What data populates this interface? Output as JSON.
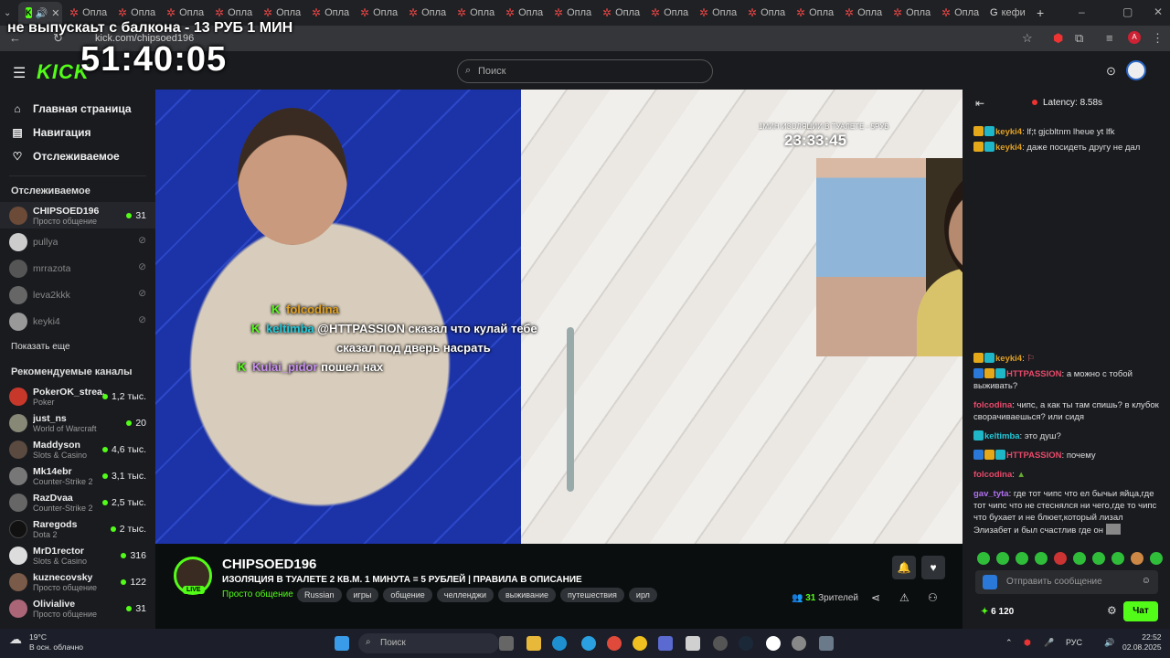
{
  "browser": {
    "tabs": {
      "first_active_label": "",
      "repeated_label": "Опла",
      "last_label": "кефи"
    },
    "url": "kick.com/chipsoed196"
  },
  "overlay": {
    "title": "не выпускаьт с балкона - 13 РУБ 1 МИН",
    "timer": "51:40:05"
  },
  "header": {
    "logo": "KICK",
    "search_placeholder": "Поиск"
  },
  "sidebar": {
    "nav": [
      {
        "label": "Главная страница",
        "icon": "home-icon"
      },
      {
        "label": "Навигация",
        "icon": "compass-icon"
      },
      {
        "label": "Отслеживаемое",
        "icon": "heart-icon"
      }
    ],
    "following_title": "Отслеживаемое",
    "following": [
      {
        "name": "CHIPSOED196",
        "category": "Просто общение",
        "count": "31",
        "live": true
      },
      {
        "name": "pullya",
        "category": "",
        "count": "",
        "live": false
      },
      {
        "name": "mrrazota",
        "category": "",
        "count": "",
        "live": false
      },
      {
        "name": "leva2kkk",
        "category": "",
        "count": "",
        "live": false
      },
      {
        "name": "keyki4",
        "category": "",
        "count": "",
        "live": false
      }
    ],
    "show_more": "Показать еще",
    "recommended_title": "Рекомендуемые каналы",
    "recommended": [
      {
        "name": "PokerOK_strea...",
        "category": "Poker",
        "count": "1,2 тыс."
      },
      {
        "name": "just_ns",
        "category": "World of Warcraft",
        "count": "20"
      },
      {
        "name": "Maddyson",
        "category": "Slots & Casino",
        "count": "4,6 тыс."
      },
      {
        "name": "Mk14ebr",
        "category": "Counter-Strike 2",
        "count": "3,1 тыс."
      },
      {
        "name": "RazDvaa",
        "category": "Counter-Strike 2",
        "count": "2,5 тыс."
      },
      {
        "name": "Raregods",
        "category": "Dota 2",
        "count": "2 тыс."
      },
      {
        "name": "MrD1rector",
        "category": "Slots & Casino",
        "count": "316"
      },
      {
        "name": "kuznecovsky",
        "category": "Просто общение",
        "count": "122"
      },
      {
        "name": "Olivialive",
        "category": "Просто общение",
        "count": "31"
      }
    ]
  },
  "video": {
    "timer_caption": "1МИН ИЗОЛЯЦИИ В ТУАЛЕТЕ - 5РУБ",
    "timer": "23:33:45",
    "overlay_chat": [
      {
        "user": "folcodina",
        "text": "",
        "color": "#e0a020"
      },
      {
        "user": "keltimba",
        "text": "@HTTPASSION сказал что кулай тебе",
        "color": "#22c8d8"
      },
      {
        "user": "",
        "text": "сказал под дверь насрать",
        "color": "#ffffff"
      },
      {
        "user": "Kulai_pidor",
        "text": "пошел нах",
        "color": "#c890f0"
      }
    ]
  },
  "stream": {
    "name": "CHIPSOED196",
    "live_badge": "LIVE",
    "title": "ИЗОЛЯЦИЯ В ТУАЛЕТЕ 2 КВ.М. 1 МИНУТА = 5 РУБЛЕЙ | ПРАВИЛА В ОПИСАНИЕ",
    "category": "Просто общение",
    "tags": [
      "Russian",
      "игры",
      "общение",
      "челленджи",
      "выживание",
      "путешествия",
      "ирл"
    ],
    "viewers_count": "31",
    "viewers_label": "Зрителей"
  },
  "chat": {
    "latency": "Latency: 8.58s",
    "messages": [
      {
        "user": "keyki4",
        "color": "#e0a020",
        "text": "lf;t gjcbltnm lheue yt lfk",
        "badges": 2
      },
      {
        "user": "keyki4",
        "color": "#e0a020",
        "text": "даже посидеть другу не дал",
        "badges": 2
      },
      {
        "user": "keyki4",
        "color": "#e0a020",
        "text": "",
        "badges": 2
      },
      {
        "user": "HTTPASSION",
        "color": "#e84a6a",
        "text": "а можно с тобой выживать?",
        "badges": 3
      },
      {
        "user": "folcodina",
        "color": "#e84a6a",
        "text": "чипс, а как ты там спишь? в клубок сворачиваешься? или сидя",
        "badges": 0
      },
      {
        "user": "keltimba",
        "color": "#22c8d8",
        "text": "это душ?",
        "badges": 1
      },
      {
        "user": "HTTPASSION",
        "color": "#e84a6a",
        "text": "почему",
        "badges": 3
      },
      {
        "user": "folcodina",
        "color": "#e84a6a",
        "text": "",
        "badges": 0
      },
      {
        "user": "gav_tyta",
        "color": "#b070f0",
        "text": "где тот чипс что ел бычьи яйца,где тот чипс что не стеснялся ни чего,где то чипс что бухает и не блюет,который лизал Элизабет и был счастлив где он",
        "badges": 0
      }
    ],
    "input_placeholder": "Отправить сообщение",
    "points": "6 120",
    "chat_button": "Чат"
  },
  "taskbar": {
    "weather_temp": "19°C",
    "weather_desc": "В осн. облачно",
    "search": "Поиск",
    "lang": "РУС",
    "time": "22:52",
    "date": "02.08.2025"
  },
  "colors": {
    "accent": "#53fc18",
    "bg": "#0b0e0f",
    "panel": "#191b1f"
  }
}
